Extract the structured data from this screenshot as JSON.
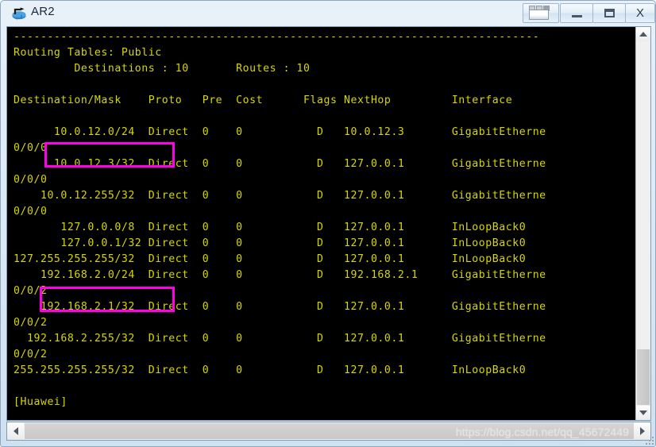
{
  "window": {
    "title": "AR2",
    "app_icon": "router-icon",
    "buttons": {
      "window_list": "window-list-icon",
      "minimize": "minimize-icon",
      "maximize": "maximize-icon",
      "close": "X"
    }
  },
  "terminal": {
    "prompt": "[Huawei]",
    "foreground_color": "#d6d600",
    "background_color": "#000000",
    "content": "------------------------------------------------------------------------------\nRouting Tables: Public\n         Destinations : 10       Routes : 10\n\nDestination/Mask    Proto   Pre  Cost      Flags NextHop         Interface\n\n      10.0.12.0/24  Direct  0    0           D   10.0.12.3       GigabitEtherne\n0/0/0\n      10.0.12.3/32  Direct  0    0           D   127.0.0.1       GigabitEtherne\n0/0/0\n    10.0.12.255/32  Direct  0    0           D   127.0.0.1       GigabitEtherne\n0/0/0\n       127.0.0.0/8  Direct  0    0           D   127.0.0.1       InLoopBack0\n       127.0.0.1/32 Direct  0    0           D   127.0.0.1       InLoopBack0\n127.255.255.255/32  Direct  0    0           D   127.0.0.1       InLoopBack0\n    192.168.2.0/24  Direct  0    0           D   192.168.2.1     GigabitEtherne\n0/0/2\n    192.168.2.1/32  Direct  0    0           D   127.0.0.1       GigabitEtherne\n0/0/2\n  192.168.2.255/32  Direct  0    0           D   127.0.0.1       GigabitEtherne\n0/0/2\n255.255.255.255/32  Direct  0    0           D   127.0.0.1       InLoopBack0\n\n[Huawei]",
    "headers": [
      "Destination/Mask",
      "Proto",
      "Pre",
      "Cost",
      "Flags",
      "NextHop",
      "Interface"
    ],
    "summary": {
      "table_name": "Routing Tables: Public",
      "destinations_label": "Destinations :",
      "destinations": "10",
      "routes_label": "Routes :",
      "routes": "10"
    },
    "routes": [
      {
        "dest": "10.0.12.0/24",
        "proto": "Direct",
        "pre": "0",
        "cost": "0",
        "flags": "D",
        "nexthop": "10.0.12.3",
        "interface": "GigabitEthernet0/0/0"
      },
      {
        "dest": "10.0.12.3/32",
        "proto": "Direct",
        "pre": "0",
        "cost": "0",
        "flags": "D",
        "nexthop": "127.0.0.1",
        "interface": "GigabitEthernet0/0/0"
      },
      {
        "dest": "10.0.12.255/32",
        "proto": "Direct",
        "pre": "0",
        "cost": "0",
        "flags": "D",
        "nexthop": "127.0.0.1",
        "interface": "GigabitEthernet0/0/0"
      },
      {
        "dest": "127.0.0.0/8",
        "proto": "Direct",
        "pre": "0",
        "cost": "0",
        "flags": "D",
        "nexthop": "127.0.0.1",
        "interface": "InLoopBack0"
      },
      {
        "dest": "127.0.0.1/32",
        "proto": "Direct",
        "pre": "0",
        "cost": "0",
        "flags": "D",
        "nexthop": "127.0.0.1",
        "interface": "InLoopBack0"
      },
      {
        "dest": "127.255.255.255/32",
        "proto": "Direct",
        "pre": "0",
        "cost": "0",
        "flags": "D",
        "nexthop": "127.0.0.1",
        "interface": "InLoopBack0"
      },
      {
        "dest": "192.168.2.0/24",
        "proto": "Direct",
        "pre": "0",
        "cost": "0",
        "flags": "D",
        "nexthop": "192.168.2.1",
        "interface": "GigabitEthernet0/0/2"
      },
      {
        "dest": "192.168.2.1/32",
        "proto": "Direct",
        "pre": "0",
        "cost": "0",
        "flags": "D",
        "nexthop": "127.0.0.1",
        "interface": "GigabitEthernet0/0/2"
      },
      {
        "dest": "192.168.2.255/32",
        "proto": "Direct",
        "pre": "0",
        "cost": "0",
        "flags": "D",
        "nexthop": "127.0.0.1",
        "interface": "GigabitEthernet0/0/2"
      },
      {
        "dest": "255.255.255.255/32",
        "proto": "Direct",
        "pre": "0",
        "cost": "0",
        "flags": "D",
        "nexthop": "127.0.0.1",
        "interface": "InLoopBack0"
      }
    ]
  },
  "annotations": {
    "color": "#ff00e8",
    "boxes": [
      {
        "label": "10.0.12.0/24"
      },
      {
        "label": "192.168.2.0/24"
      }
    ]
  },
  "status_bar": {
    "watermark": "https://blog.csdn.net/qq_45672449"
  }
}
